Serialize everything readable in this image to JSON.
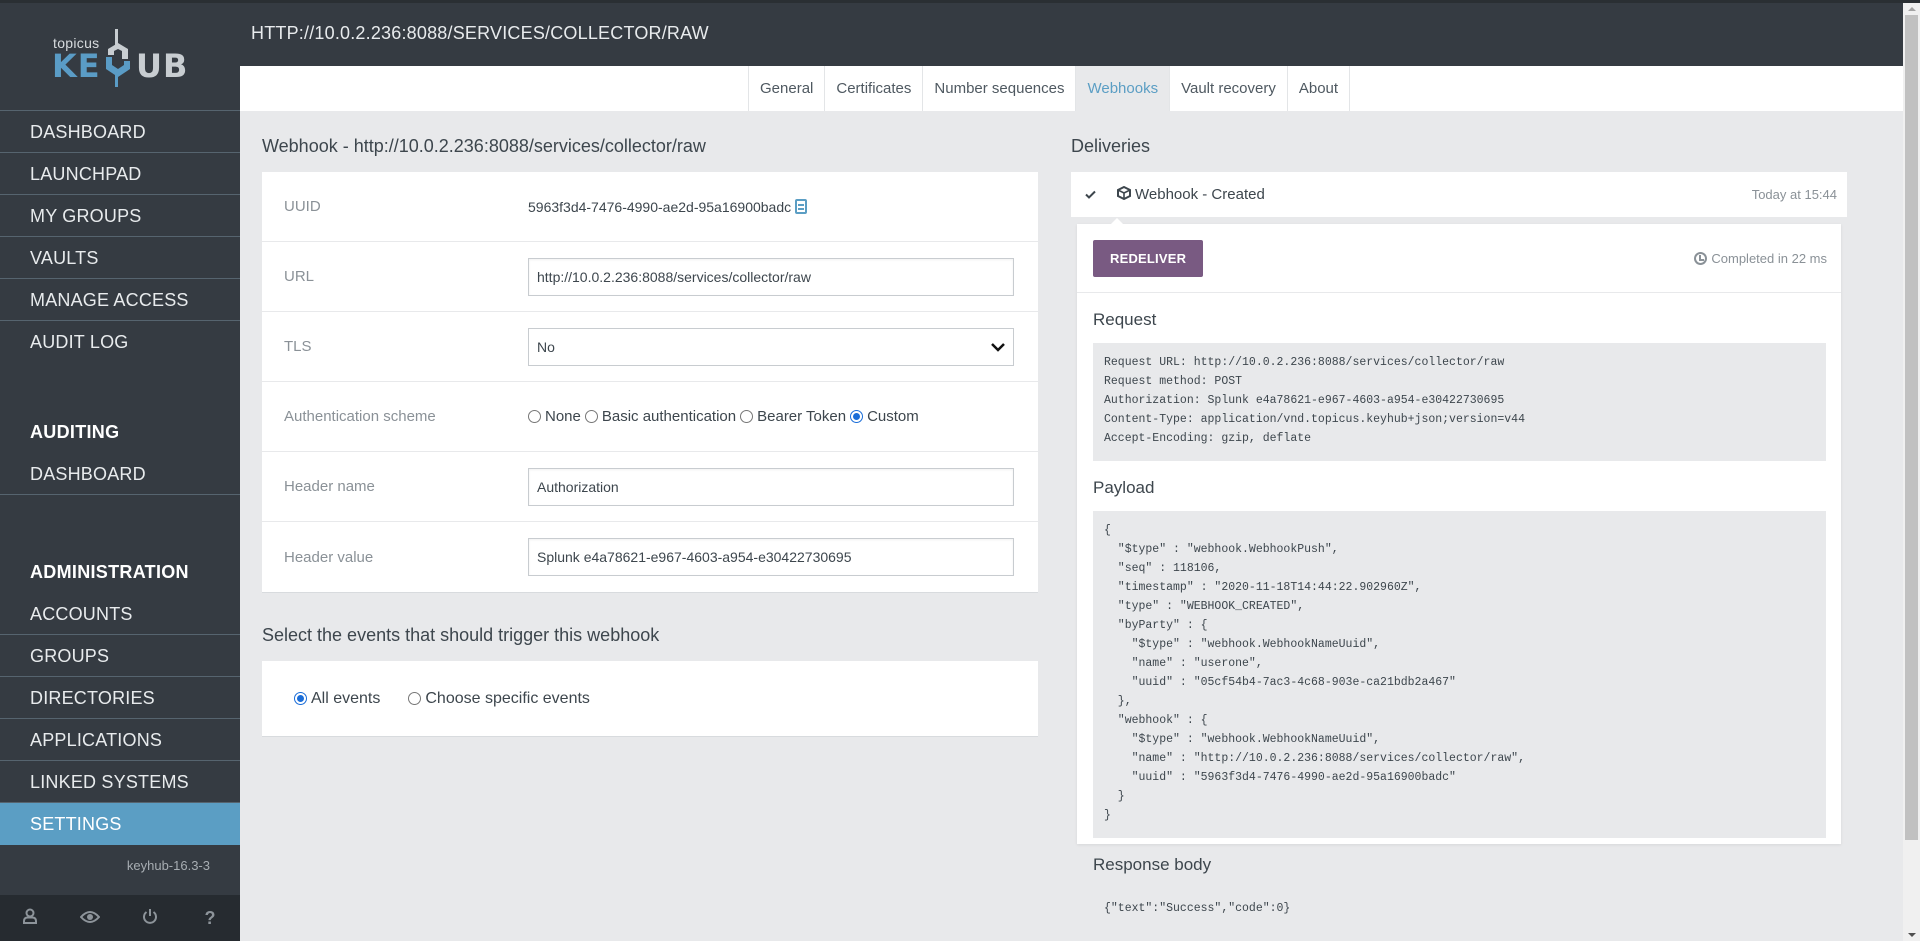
{
  "app": {
    "logo_small": "topicus",
    "logo_key": "KEY",
    "logo_hub": "HUB",
    "version": "keyhub-16.3-3"
  },
  "sidebar": {
    "main_items": [
      {
        "label": "DASHBOARD"
      },
      {
        "label": "LAUNCHPAD"
      },
      {
        "label": "MY GROUPS"
      },
      {
        "label": "VAULTS"
      },
      {
        "label": "MANAGE ACCESS"
      },
      {
        "label": "AUDIT LOG"
      }
    ],
    "auditing": {
      "heading": "AUDITING",
      "items": [
        {
          "label": "DASHBOARD"
        }
      ]
    },
    "administration": {
      "heading": "ADMINISTRATION",
      "items": [
        {
          "label": "ACCOUNTS"
        },
        {
          "label": "GROUPS"
        },
        {
          "label": "DIRECTORIES"
        },
        {
          "label": "APPLICATIONS"
        },
        {
          "label": "LINKED SYSTEMS"
        },
        {
          "label": "SETTINGS",
          "active": true
        }
      ]
    },
    "footer_icons": [
      {
        "name": "user-icon",
        "glyph": "👤"
      },
      {
        "name": "eye-icon",
        "glyph": "👁"
      },
      {
        "name": "power-icon",
        "glyph": "⏻"
      },
      {
        "name": "help-icon",
        "glyph": "?"
      }
    ]
  },
  "header": {
    "title": "HTTP://10.0.2.236:8088/SERVICES/COLLECTOR/RAW"
  },
  "tabs": [
    {
      "label": "General"
    },
    {
      "label": "Certificates"
    },
    {
      "label": "Number sequences"
    },
    {
      "label": "Webhooks",
      "active": true
    },
    {
      "label": "Vault recovery"
    },
    {
      "label": "About"
    }
  ],
  "webhook": {
    "title": "Webhook - http://10.0.2.236:8088/services/collector/raw",
    "uuid_label": "UUID",
    "uuid_value": "5963f3d4-7476-4990-ae2d-95a16900badc",
    "url_label": "URL",
    "url_value": "http://10.0.2.236:8088/services/collector/raw",
    "tls_label": "TLS",
    "tls_value": "No",
    "auth_label": "Authentication scheme",
    "auth_options": [
      {
        "label": "None",
        "checked": false
      },
      {
        "label": "Basic authentication",
        "checked": false
      },
      {
        "label": "Bearer Token",
        "checked": false
      },
      {
        "label": "Custom",
        "checked": true
      }
    ],
    "header_name_label": "Header name",
    "header_name_value": "Authorization",
    "header_value_label": "Header value",
    "header_value_value": "Splunk e4a78621-e967-4603-a954-e30422730695"
  },
  "events": {
    "title": "Select the events that should trigger this webhook",
    "options": [
      {
        "label": "All events",
        "checked": true
      },
      {
        "label": "Choose specific events",
        "checked": false
      }
    ]
  },
  "deliveries": {
    "title": "Deliveries",
    "item": {
      "name": "Webhook - Created",
      "time": "Today at 15:44"
    },
    "redeliver_label": "REDELIVER",
    "completed": "Completed in 22 ms",
    "request_title": "Request",
    "request_text": "Request URL: http://10.0.2.236:8088/services/collector/raw\nRequest method: POST\nAuthorization: Splunk e4a78621-e967-4603-a954-e30422730695\nContent-Type: application/vnd.topicus.keyhub+json;version=v44\nAccept-Encoding: gzip, deflate",
    "payload_title": "Payload",
    "payload_text": "{\n  \"$type\" : \"webhook.WebhookPush\",\n  \"seq\" : 118106,\n  \"timestamp\" : \"2020-11-18T14:44:22.902960Z\",\n  \"type\" : \"WEBHOOK_CREATED\",\n  \"byParty\" : {\n    \"$type\" : \"webhook.WebhookNameUuid\",\n    \"name\" : \"userone\",\n    \"uuid\" : \"05cf54b4-7ac3-4c68-903e-ca21bdb2a467\"\n  },\n  \"webhook\" : {\n    \"$type\" : \"webhook.WebhookNameUuid\",\n    \"name\" : \"http://10.0.2.236:8088/services/collector/raw\",\n    \"uuid\" : \"5963f3d4-7476-4990-ae2d-95a16900badc\"\n  }\n}",
    "response_title": "Response body",
    "response_text": "{\"text\":\"Success\",\"code\":0}"
  },
  "colors": {
    "sidebar_bg": "#353b42",
    "accent": "#5b9ec4",
    "redeliver": "#795a82",
    "page_bg": "#e8e9eb"
  }
}
